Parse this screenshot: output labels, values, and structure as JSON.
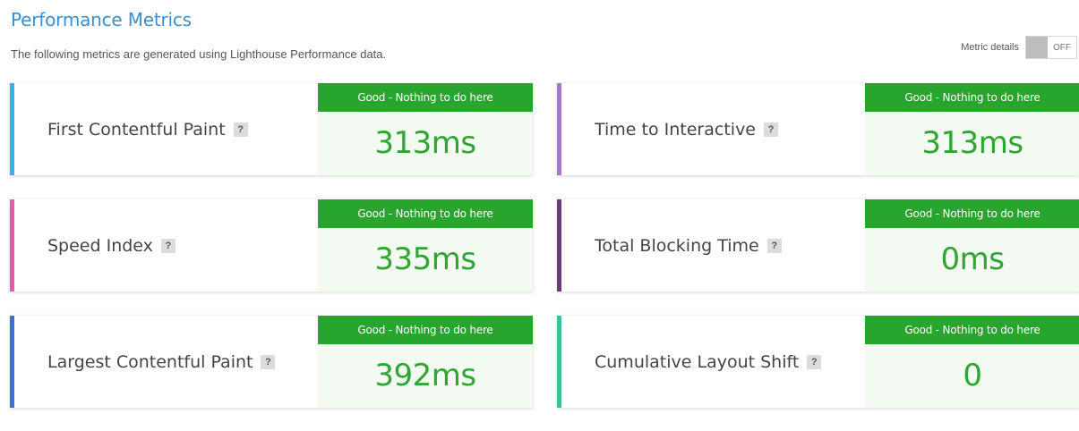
{
  "header": {
    "title": "Performance Metrics",
    "subtitle": "The following metrics are generated using Lighthouse Performance data."
  },
  "toggle": {
    "label": "Metric details",
    "state": "OFF"
  },
  "colors": {
    "status_green": "#27a52c",
    "value_green": "#2fa532",
    "title_blue": "#3a8fd0"
  },
  "metrics": [
    {
      "name": "First Contentful Paint",
      "help": "?",
      "status": "Good - Nothing to do here",
      "value": "313ms",
      "accent": "#33b3e6"
    },
    {
      "name": "Time to Interactive",
      "help": "?",
      "status": "Good - Nothing to do here",
      "value": "313ms",
      "accent": "#a678c8"
    },
    {
      "name": "Speed Index",
      "help": "?",
      "status": "Good - Nothing to do here",
      "value": "335ms",
      "accent": "#e65ca8"
    },
    {
      "name": "Total Blocking Time",
      "help": "?",
      "status": "Good - Nothing to do here",
      "value": "0ms",
      "accent": "#6b3a78"
    },
    {
      "name": "Largest Contentful Paint",
      "help": "?",
      "status": "Good - Nothing to do here",
      "value": "392ms",
      "accent": "#3f6fd6"
    },
    {
      "name": "Cumulative Layout Shift",
      "help": "?",
      "status": "Good - Nothing to do here",
      "value": "0",
      "accent": "#3fbf9b"
    }
  ]
}
